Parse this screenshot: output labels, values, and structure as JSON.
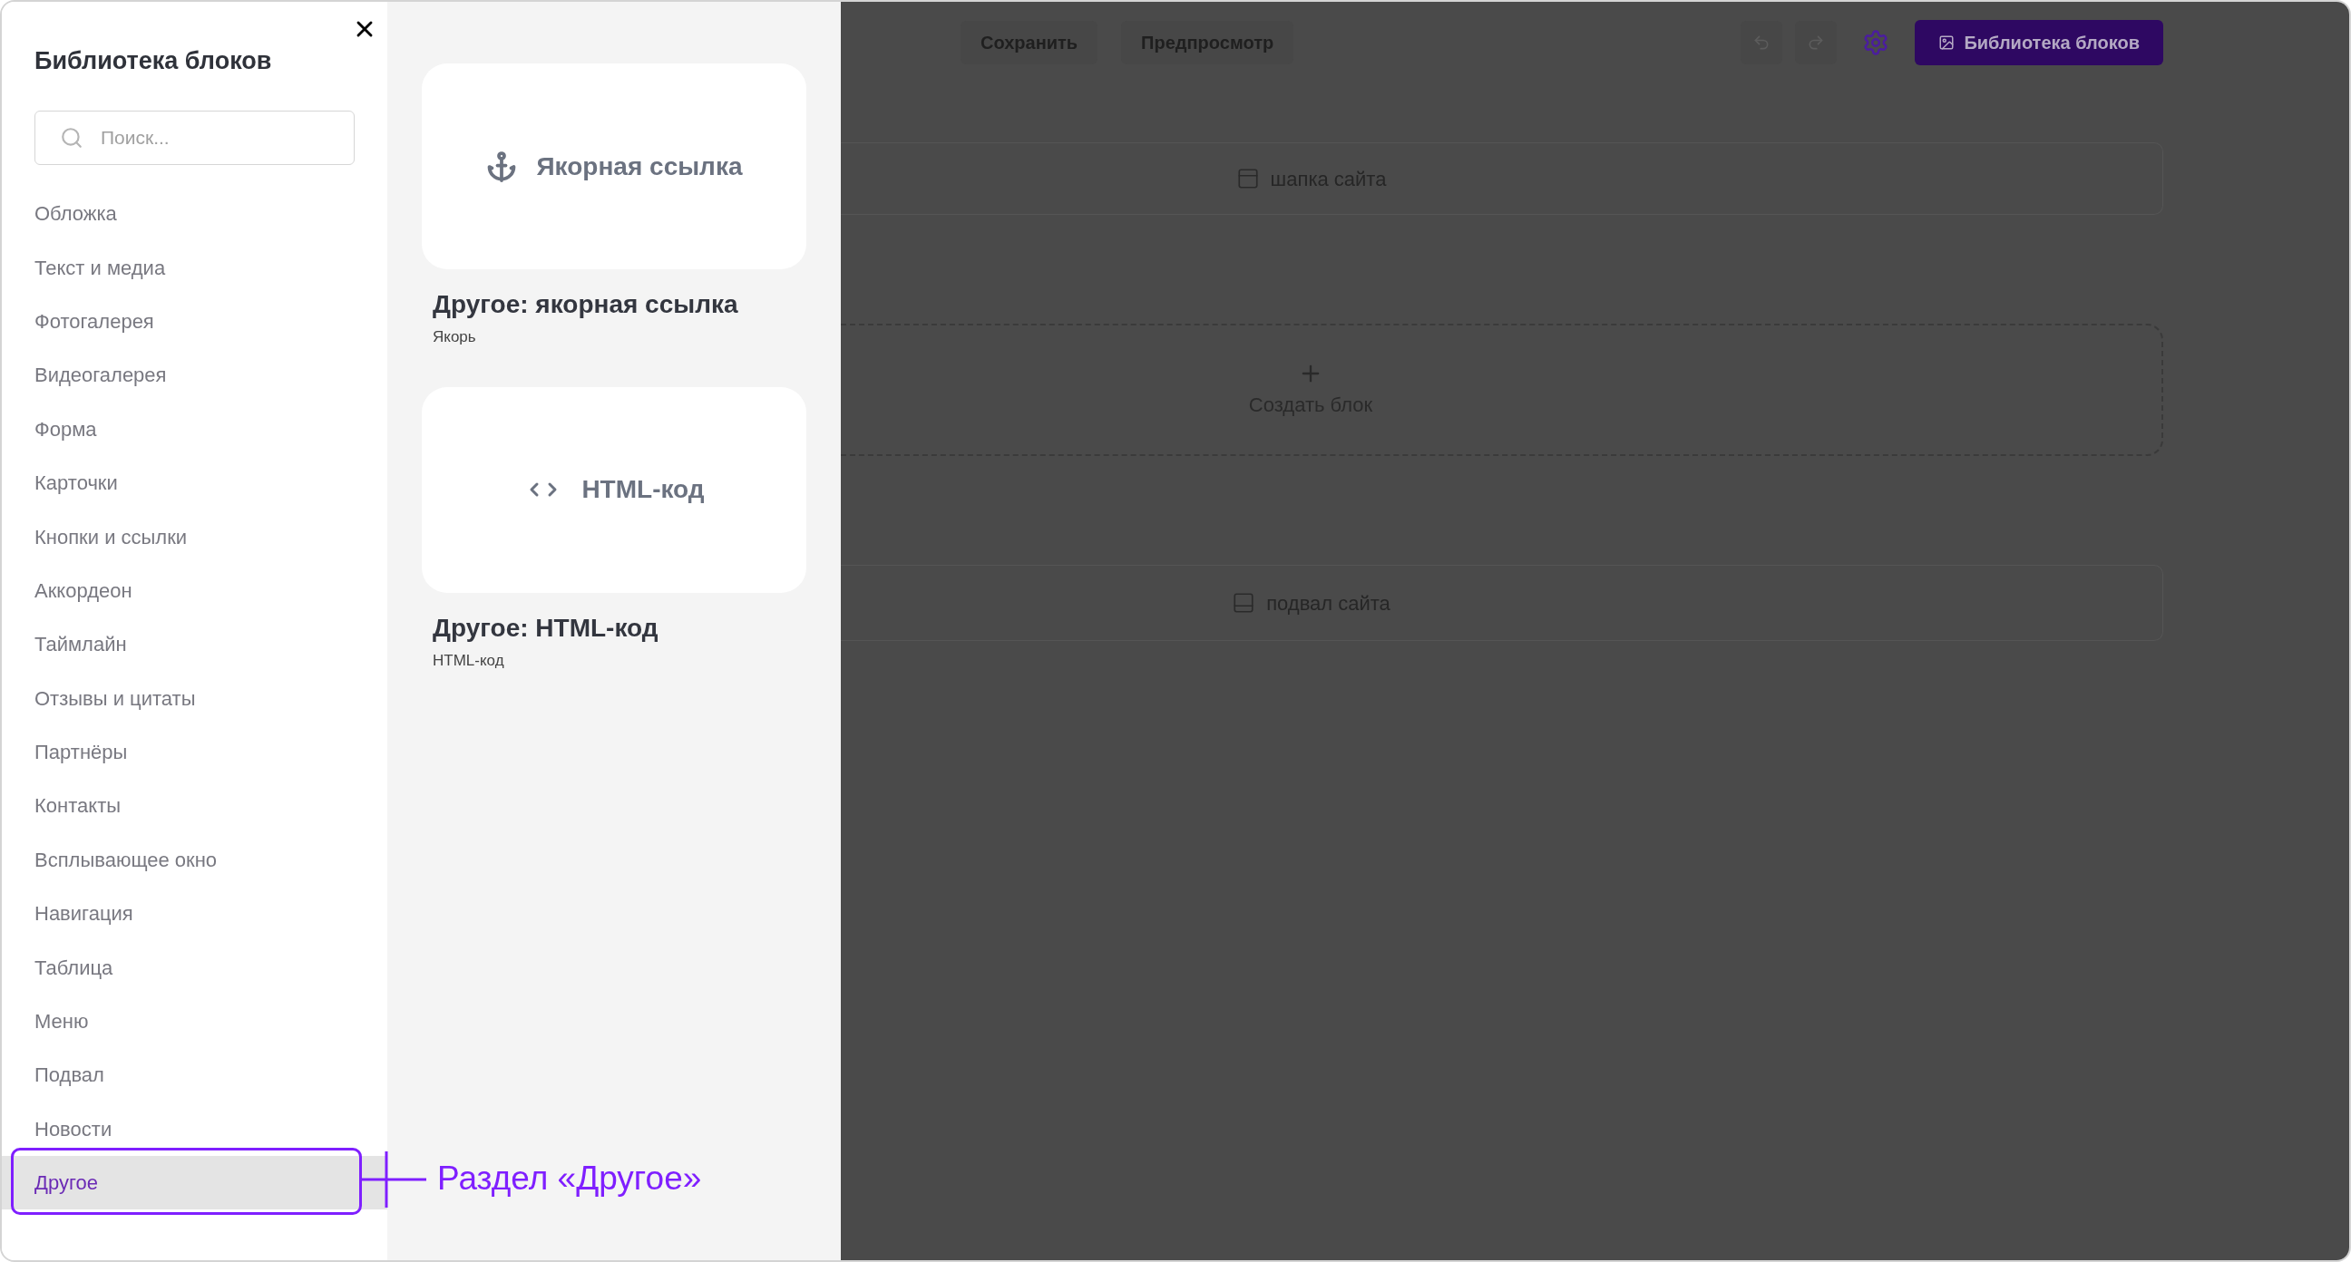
{
  "sidebar": {
    "title": "Библиотека блоков",
    "search": {
      "placeholder": "Поиск..."
    },
    "items": [
      {
        "label": "Обложка",
        "selected": false
      },
      {
        "label": "Текст и медиа",
        "selected": false
      },
      {
        "label": "Фотогалерея",
        "selected": false
      },
      {
        "label": "Видеогалерея",
        "selected": false
      },
      {
        "label": "Форма",
        "selected": false
      },
      {
        "label": "Карточки",
        "selected": false
      },
      {
        "label": "Кнопки и ссылки",
        "selected": false
      },
      {
        "label": "Аккордеон",
        "selected": false
      },
      {
        "label": "Таймлайн",
        "selected": false
      },
      {
        "label": "Отзывы и цитаты",
        "selected": false
      },
      {
        "label": "Партнёры",
        "selected": false
      },
      {
        "label": "Контакты",
        "selected": false
      },
      {
        "label": "Всплывающее окно",
        "selected": false
      },
      {
        "label": "Навигация",
        "selected": false
      },
      {
        "label": "Таблица",
        "selected": false
      },
      {
        "label": "Меню",
        "selected": false
      },
      {
        "label": "Подвал",
        "selected": false
      },
      {
        "label": "Новости",
        "selected": false
      },
      {
        "label": "Другое",
        "selected": true
      }
    ]
  },
  "cards": [
    {
      "kind": "anchor",
      "preview": "Якорная ссылка",
      "title": "Другое: якорная ссылка",
      "subtitle": "Якорь"
    },
    {
      "kind": "code",
      "preview": "HTML-код",
      "title": "Другое: HTML-код",
      "subtitle": "HTML-код"
    }
  ],
  "editor": {
    "toolbar": {
      "save": "Сохранить",
      "preview": "Предпросмотр",
      "library": "Библиотека блоков"
    },
    "header_block": "шапка сайта",
    "create_block": "Создать блок",
    "footer_block": "подвал сайта"
  },
  "callout": "Раздел «Другое»"
}
